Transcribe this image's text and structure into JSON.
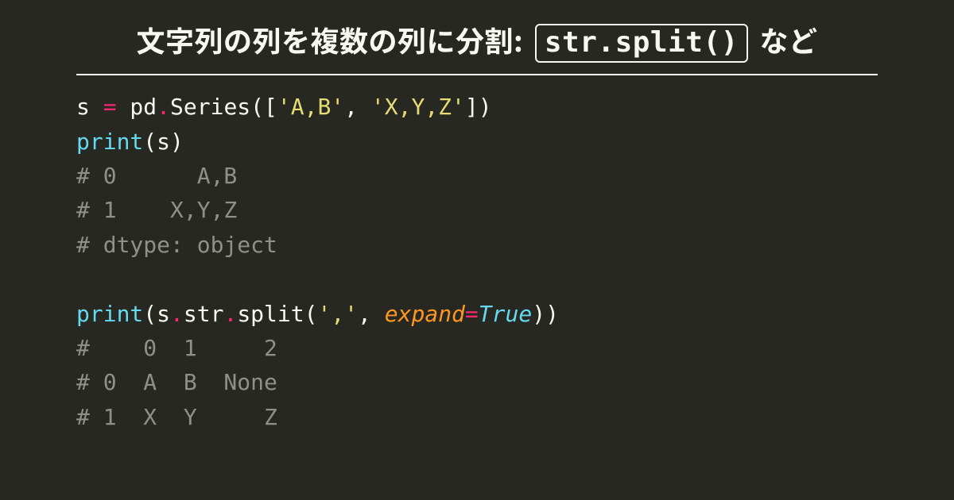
{
  "title": {
    "prefix": "文字列の列を複数の列に分割: ",
    "code": "str.split()",
    "suffix": " など"
  },
  "code": {
    "line1": {
      "s": "s ",
      "eq": "=",
      "sp1": " pd",
      "dot1": ".",
      "series": "Series([",
      "str1": "'A,B'",
      "comma": ", ",
      "str2": "'X,Y,Z'",
      "close": "])"
    },
    "line2": {
      "print": "print",
      "open": "(s)",
      "_raw": "print(s)"
    },
    "line3": "# 0      A,B",
    "line4": "# 1    X,Y,Z",
    "line5": "# dtype: object",
    "blank": "",
    "line7": {
      "print": "print",
      "open": "(s",
      "dot1": ".",
      "str_attr": "str",
      "dot2": ".",
      "split": "split(",
      "arg_str": "','",
      "comma": ", ",
      "kwarg": "expand",
      "eq": "=",
      "true": "True",
      "close": "))"
    },
    "line8": "#    0  1     2",
    "line9": "# 0  A  B  None",
    "line10": "# 1  X  Y     Z"
  }
}
